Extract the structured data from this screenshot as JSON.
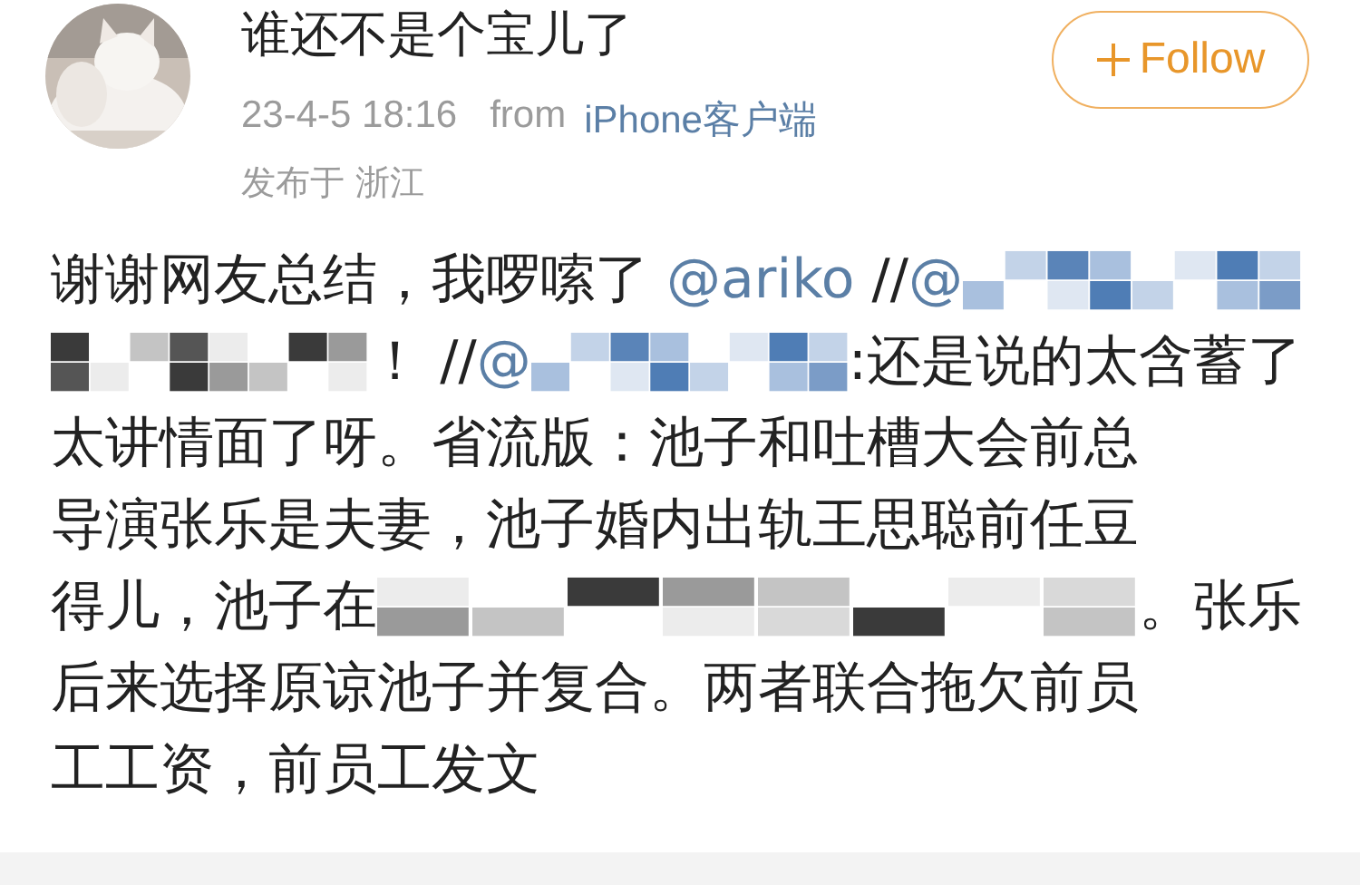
{
  "post": {
    "author": "谁还不是个宝儿了",
    "follow_button": {
      "label": "Follow"
    },
    "time": "23-4-5 18:16",
    "source_prefix": "from",
    "source": "iPhone客户端",
    "location": "发布于 浙江",
    "lines": [
      [
        {
          "kind": "text",
          "text": "谢谢网友总结，我啰嗦了 "
        },
        {
          "kind": "mention",
          "text": "@ariko"
        },
        {
          "kind": "text",
          "text": " //"
        },
        {
          "kind": "mention",
          "text": "@"
        },
        {
          "kind": "link_redaction"
        }
      ],
      [
        {
          "kind": "redaction"
        },
        {
          "kind": "text",
          "text": "！ //"
        },
        {
          "kind": "mention",
          "text": "@"
        },
        {
          "kind": "link_redaction"
        },
        {
          "kind": "text",
          "text": ":还是说的太含蓄了"
        }
      ],
      [
        {
          "kind": "text",
          "text": "太讲情面了呀。省流版：池子和吐槽大会前总"
        }
      ],
      [
        {
          "kind": "text",
          "text": "导演张乐是夫妻，池子婚内出轨王思聪前任豆"
        }
      ],
      [
        {
          "kind": "text",
          "text": "得儿，池子在"
        },
        {
          "kind": "redaction"
        },
        {
          "kind": "text",
          "text": "。张乐"
        }
      ],
      [
        {
          "kind": "text",
          "text": "后来选择原谅池子并复合。两者联合拖欠前员"
        }
      ],
      [
        {
          "kind": "text",
          "text": "工工资，前员工发文"
        }
      ]
    ]
  }
}
